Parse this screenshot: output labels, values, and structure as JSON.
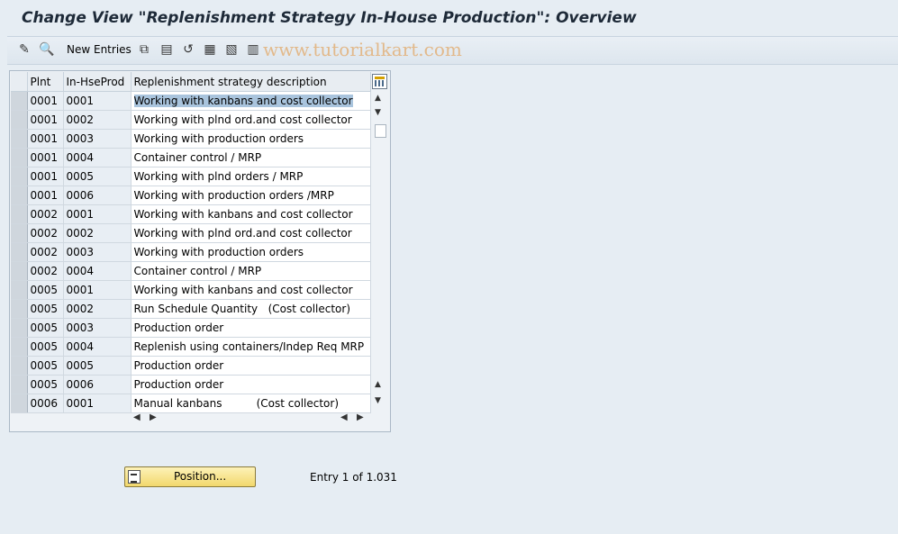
{
  "title": "Change View \"Replenishment Strategy In-House Production\": Overview",
  "toolbar": {
    "new_entries_label": "New Entries",
    "icons": [
      "display-change-icon",
      "details-icon",
      "copy-icon",
      "delete-icon",
      "undo-icon",
      "select-all-icon",
      "select-block-icon",
      "deselect-all-icon"
    ]
  },
  "watermark": "www.tutorialkart.com",
  "table": {
    "columns": [
      "Plnt",
      "In-HseProd",
      "Replenishment strategy description"
    ],
    "rows": [
      [
        "0001",
        "0001",
        "Working with kanbans and cost collector"
      ],
      [
        "0001",
        "0002",
        "Working with plnd ord.and cost collector"
      ],
      [
        "0001",
        "0003",
        "Working with production orders"
      ],
      [
        "0001",
        "0004",
        "Container control / MRP"
      ],
      [
        "0001",
        "0005",
        "Working with plnd orders / MRP"
      ],
      [
        "0001",
        "0006",
        "Working with production orders /MRP"
      ],
      [
        "0002",
        "0001",
        "Working with kanbans and cost collector"
      ],
      [
        "0002",
        "0002",
        "Working with plnd ord.and cost collector"
      ],
      [
        "0002",
        "0003",
        "Working with production orders"
      ],
      [
        "0002",
        "0004",
        "Container control / MRP"
      ],
      [
        "0005",
        "0001",
        "Working with kanbans and cost collector"
      ],
      [
        "0005",
        "0002",
        "Run Schedule Quantity   (Cost collector)"
      ],
      [
        "0005",
        "0003",
        "Production order"
      ],
      [
        "0005",
        "0004",
        "Replenish using containers/Indep Req MRP"
      ],
      [
        "0005",
        "0005",
        "Production order"
      ],
      [
        "0005",
        "0006",
        "Production order"
      ],
      [
        "0006",
        "0001",
        "Manual kanbans          (Cost collector)"
      ]
    ]
  },
  "position_button_label": "Position...",
  "entry_text": "Entry 1 of 1.031"
}
